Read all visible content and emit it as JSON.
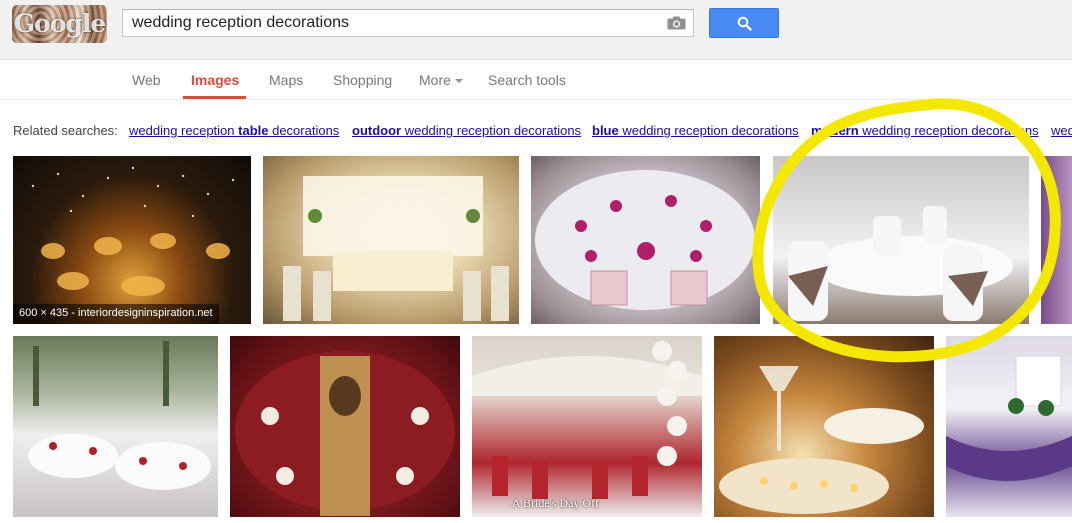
{
  "search": {
    "query": "wedding reception decorations",
    "logo_text": "Google"
  },
  "nav": {
    "web": "Web",
    "images": "Images",
    "maps": "Maps",
    "shopping": "Shopping",
    "more": "More",
    "search_tools": "Search tools",
    "active": "Images"
  },
  "related": {
    "label": "Related searches:",
    "items": [
      {
        "bold": "",
        "pre": "wedding reception ",
        "mid": "table",
        "post": " decorations"
      },
      {
        "bold": "outdoor",
        "pre": " wedding reception decorations",
        "mid": "",
        "post": ""
      },
      {
        "bold": "blue",
        "pre": " wedding reception decorations",
        "mid": "",
        "post": ""
      },
      {
        "bold": "modern",
        "pre": " wedding reception decorations",
        "mid": "",
        "post": ""
      },
      {
        "bold": "",
        "pre": "wed",
        "mid": "",
        "post": ""
      }
    ]
  },
  "results": {
    "first_caption": "600 × 435 - interiordesigninspiration.net",
    "watermark": "A Bride's Day Off"
  },
  "colors": {
    "accent_red": "#dd4b39",
    "button_blue": "#4a8af4",
    "link_blue": "#1a0dab",
    "highlight_yellow": "#f5e800"
  },
  "icons": [
    "camera-icon",
    "search-icon",
    "chevron-down-icon"
  ]
}
